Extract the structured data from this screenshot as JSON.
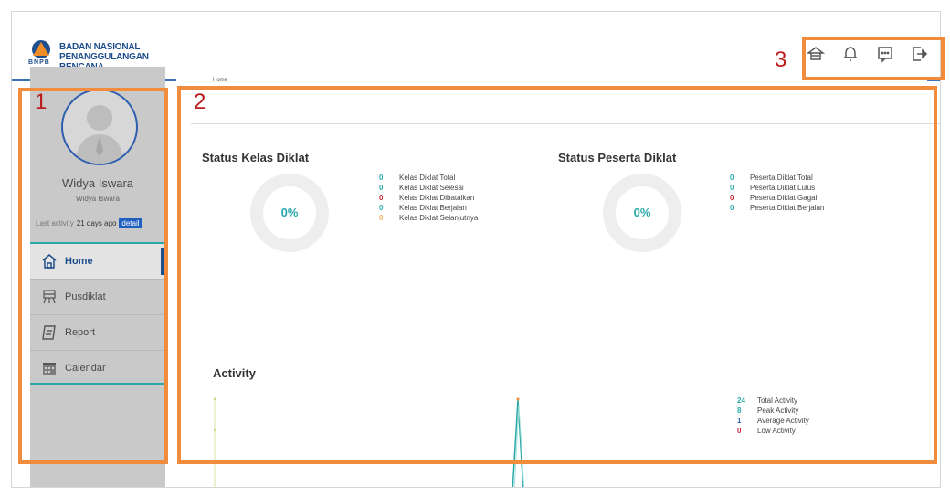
{
  "brand": {
    "line1": "BADAN NASIONAL",
    "line2": "PENANGGULANGAN BENCANA",
    "abbr": "BNPB"
  },
  "topbar": {
    "icons": [
      "home-icon",
      "bell-icon",
      "chat-icon",
      "logout-icon"
    ]
  },
  "user": {
    "name": "Widya Iswara",
    "role": "Widya Iswara",
    "last_activity_label": "Last activity",
    "last_activity_value": "21 days ago",
    "detail_label": "detail"
  },
  "nav": {
    "items": [
      {
        "label": "Home",
        "icon": "home-icon",
        "active": true
      },
      {
        "label": "Pusdiklat",
        "icon": "pusdiklat-icon",
        "active": false
      },
      {
        "label": "Report",
        "icon": "report-icon",
        "active": false
      },
      {
        "label": "Calendar",
        "icon": "calendar-icon",
        "active": false
      }
    ]
  },
  "breadcrumb": "Home",
  "kelas": {
    "title": "Status Kelas Diklat",
    "percent": "0%",
    "legend": [
      {
        "value": "0",
        "label": "Kelas Diklat Total",
        "color": "#2aa8a8"
      },
      {
        "value": "0",
        "label": "Kelas Diklat Selesai",
        "color": "#2aa8a8"
      },
      {
        "value": "0",
        "label": "Kelas Diklat Dibatalkan",
        "color": "#c0263a"
      },
      {
        "value": "0",
        "label": "Kelas Diklat Berjalan",
        "color": "#2aa8a8"
      },
      {
        "value": "0",
        "label": "Kelas Diklat Selanjutnya",
        "color": "#f2b35f"
      }
    ]
  },
  "peserta": {
    "title": "Status Peserta Diklat",
    "percent": "0%",
    "legend": [
      {
        "value": "0",
        "label": "Peserta Diklat Total",
        "color": "#2aa8a8"
      },
      {
        "value": "0",
        "label": "Peserta Diklat Lulus",
        "color": "#2aa8a8"
      },
      {
        "value": "0",
        "label": "Peserta Diklat Gagal",
        "color": "#c0263a"
      },
      {
        "value": "0",
        "label": "Peserta Diklat Berjalan",
        "color": "#2aa8a8"
      }
    ]
  },
  "activity": {
    "title": "Activity",
    "legend": [
      {
        "value": "24",
        "label": "Total Activity",
        "color": "#2aa8a8"
      },
      {
        "value": "8",
        "label": "Peak Activity",
        "color": "#2aa8a8"
      },
      {
        "value": "1",
        "label": "Average Activity",
        "color": "#2f5fae"
      },
      {
        "value": "0",
        "label": "Low Activity",
        "color": "#c0263a"
      }
    ]
  },
  "annotations": [
    "1",
    "2",
    "3"
  ],
  "colors": {
    "accent": "#2aa8a8",
    "brand_blue": "#1f4e8c",
    "annotation_orange": "#f08c3c",
    "annotation_red": "#b91d1d"
  }
}
